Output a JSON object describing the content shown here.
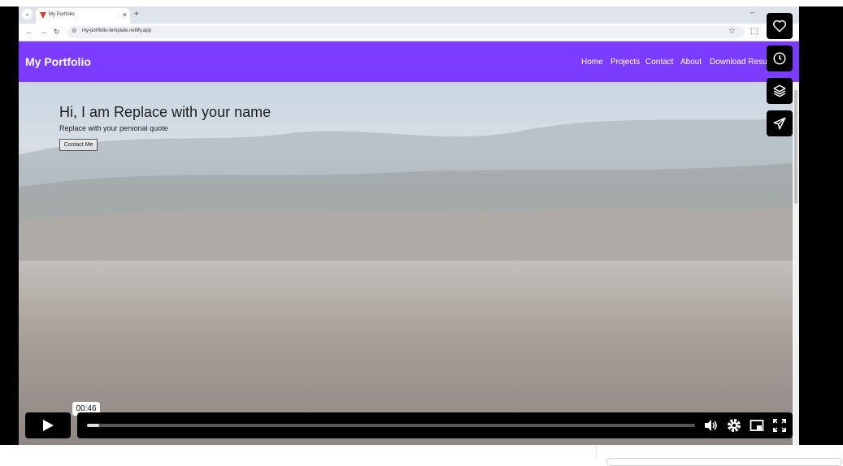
{
  "browser": {
    "tab_title": "My Portfolio",
    "tab_close": "×",
    "new_tab": "+",
    "minimize": "–",
    "url": "my-portfolio-template.netlify.app"
  },
  "site": {
    "brand": "My Portfolio",
    "nav": [
      {
        "label": "Home"
      },
      {
        "label": "Projects"
      },
      {
        "label": "Contact"
      },
      {
        "label": "About"
      },
      {
        "label": "Download Resum"
      }
    ],
    "hero_title": "Hi, I am Replace with your name",
    "hero_quote": "Replace with your personal quote",
    "contact_button": "Contact Me"
  },
  "player": {
    "time": "00:46",
    "progress_fraction": 0.02,
    "side_actions": [
      "heart-icon",
      "clock-icon",
      "layers-icon",
      "send-icon"
    ]
  },
  "colors": {
    "navbar": "#7c3cff",
    "player_black": "#000000"
  }
}
